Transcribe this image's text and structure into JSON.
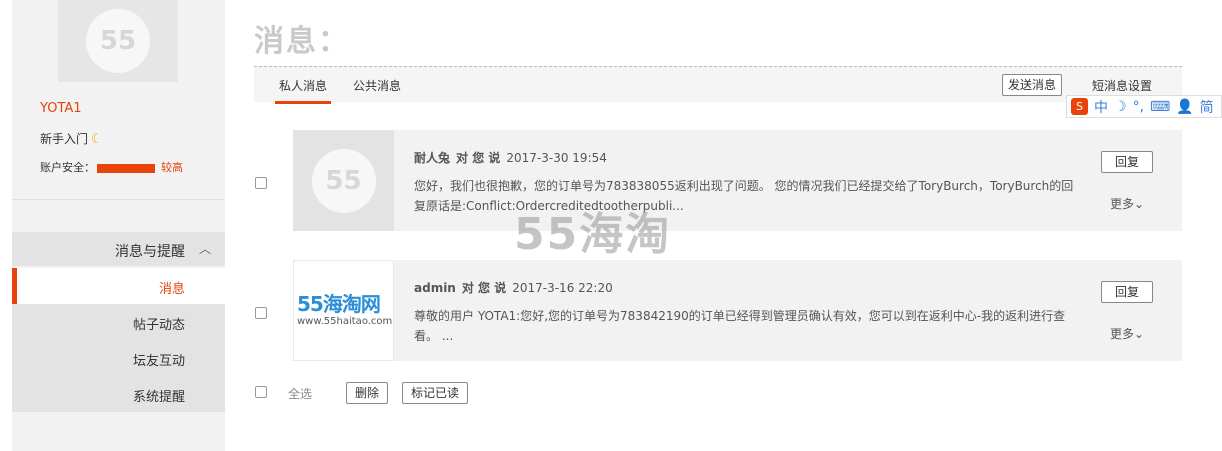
{
  "page": {
    "title": "消息："
  },
  "sidebar": {
    "avatar_text": "55",
    "username": "YOTA1",
    "novice_label": "新手入门",
    "security_label": "账户安全：",
    "security_level": "较高",
    "menu_header": "消息与提醒",
    "items": [
      {
        "label": "消息",
        "active": true
      },
      {
        "label": "帖子动态",
        "active": false
      },
      {
        "label": "坛友互动",
        "active": false
      },
      {
        "label": "系统提醒",
        "active": false
      }
    ]
  },
  "tabs": [
    {
      "label": "私人消息",
      "active": true
    },
    {
      "label": "公共消息",
      "active": false
    }
  ],
  "toolbar": {
    "send_label": "发送消息",
    "settings_label": "短消息设置"
  },
  "ime": {
    "lang": "中",
    "mode": "简"
  },
  "messages": [
    {
      "sender": "耐人兔",
      "says": "对 您 说",
      "time": "2017-3-30 19:54",
      "body": "您好，我们也很抱歉，您的订单号为783838055返利出现了问题。 您的情况我们已经提交给了ToryBurch，ToryBurch的回复原话是:Conflict:Ordercreditedtootherpubli...",
      "avatar_text": "55",
      "reply_label": "回复",
      "more_label": "更多"
    },
    {
      "sender": "admin",
      "says": "对 您 说",
      "time": "2017-3-16 22:20",
      "body": "尊敬的用户 YOTA1:您好,您的订单号为783842190的订单已经得到管理员确认有效，您可以到在返利中心-我的返利进行查看。 ...",
      "avatar_logo": "55海淘网",
      "avatar_logo_sub": "www.55haitao.com",
      "reply_label": "回复",
      "more_label": "更多"
    }
  ],
  "watermark": "55海淘",
  "bottom": {
    "select_all_label": "全选",
    "delete_label": "删除",
    "mark_read_label": "标记已读"
  }
}
